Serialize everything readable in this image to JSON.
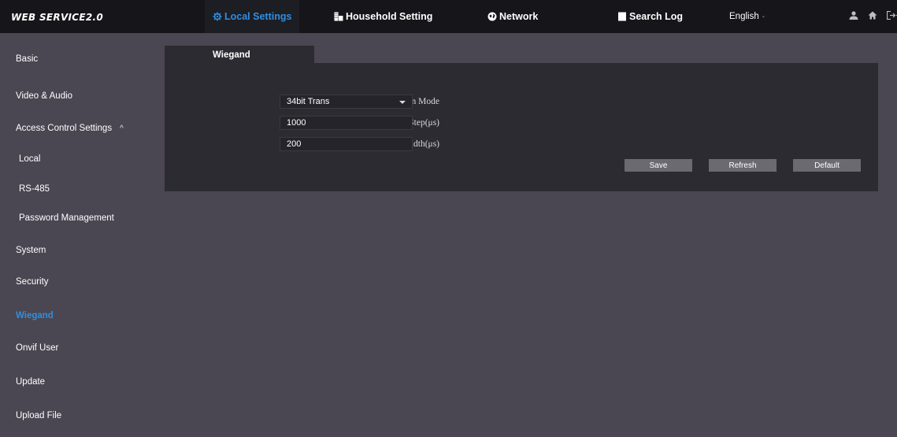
{
  "header": {
    "brand": "WEB SERVICE2.0",
    "nav": [
      {
        "label": "Local Settings",
        "icon": "gear-icon"
      },
      {
        "label": "Household Setting",
        "icon": "building-icon"
      },
      {
        "label": "Network",
        "icon": "globe-icon"
      },
      {
        "label": "Search Log",
        "icon": "document-icon"
      }
    ],
    "language": "English",
    "language_caret": "-",
    "icons": [
      "user-icon",
      "home-icon",
      "logout-icon"
    ]
  },
  "sidebar": {
    "items": [
      {
        "label": "Basic"
      },
      {
        "label": "Video & Audio"
      },
      {
        "label": "Access Control Settings",
        "chevron": "^"
      },
      {
        "label": "Local"
      },
      {
        "label": "RS-485"
      },
      {
        "label": "Password Management"
      },
      {
        "label": "System"
      },
      {
        "label": "Security"
      },
      {
        "label": "Wiegand"
      },
      {
        "label": "Onvif User"
      },
      {
        "label": "Update"
      },
      {
        "label": "Upload File"
      }
    ],
    "active": "Wiegand"
  },
  "main": {
    "tab": "Wiegand",
    "fields": {
      "transmission_mode": {
        "label": "Transmission Mode",
        "value": "34bit Trans"
      },
      "pulse_step": {
        "label": "Pulse Step(μs)",
        "value": "1000"
      },
      "pulse_width": {
        "label": "Pulse Width(μs)",
        "value": "200"
      }
    },
    "buttons": {
      "save": "Save",
      "refresh": "Refresh",
      "default": "Default"
    }
  },
  "colors": {
    "accent": "#2f8fe0",
    "topbar": "#15151a",
    "background": "#4a4752",
    "panel": "#2d2b32",
    "button": "#6c6a71"
  }
}
